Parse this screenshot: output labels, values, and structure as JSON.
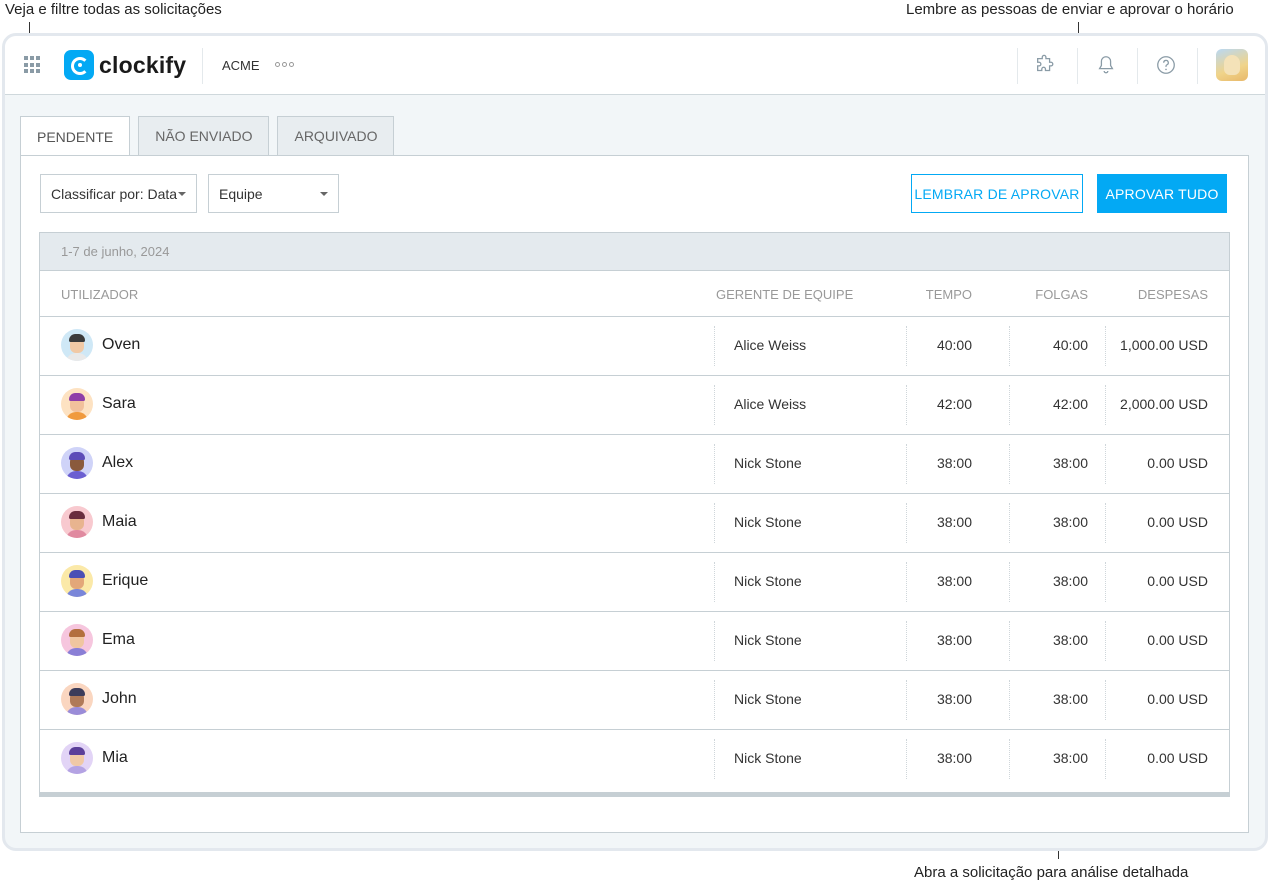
{
  "annotations": {
    "top_left": "Veja e filtre todas as solicitações",
    "top_right": "Lembre as pessoas de enviar e aprovar o horário",
    "bottom": "Abra a solicitação para análise detalhada"
  },
  "header": {
    "logo_text": "clockify",
    "workspace": "ACME",
    "icons": [
      "apps-grid-icon",
      "puzzle-icon",
      "bell-icon",
      "help-icon"
    ]
  },
  "tabs": [
    {
      "label": "PENDENTE",
      "active": true
    },
    {
      "label": "NÃO ENVIADO",
      "active": false
    },
    {
      "label": "ARQUIVADO",
      "active": false
    }
  ],
  "filters": {
    "sort": "Classificar por: Data",
    "team": "Equipe"
  },
  "actions": {
    "remind": "LEMBRAR DE APROVAR",
    "approve_all": "APROVAR TUDO"
  },
  "table": {
    "date_range": "1-7 de junho, 2024",
    "columns": {
      "user": "UTILIZADOR",
      "manager": "GERENTE DE EQUIPE",
      "time": "TEMPO",
      "timeoff": "FOLGAS",
      "expenses": "DESPESAS"
    },
    "rows": [
      {
        "name": "Oven",
        "manager": "Alice Weiss",
        "time": "40:00",
        "timeoff": "40:00",
        "expenses": "1,000.00 USD",
        "bg": "#cfe8f6",
        "hair": "#3b3b3b",
        "skin": "#f1c9a5",
        "shirt": "#e9e9e9"
      },
      {
        "name": "Sara",
        "manager": "Alice Weiss",
        "time": "42:00",
        "timeoff": "42:00",
        "expenses": "2,000.00 USD",
        "bg": "#fde2c2",
        "hair": "#8e3ea8",
        "skin": "#f2c19c",
        "shirt": "#f09a3e"
      },
      {
        "name": "Alex",
        "manager": "Nick Stone",
        "time": "38:00",
        "timeoff": "38:00",
        "expenses": "0.00 USD",
        "bg": "#cfd3f8",
        "hair": "#5c4bb8",
        "skin": "#8a5a3c",
        "shirt": "#6b5fd1"
      },
      {
        "name": "Maia",
        "manager": "Nick Stone",
        "time": "38:00",
        "timeoff": "38:00",
        "expenses": "0.00 USD",
        "bg": "#f8c9cf",
        "hair": "#6a2d3e",
        "skin": "#e8b48f",
        "shirt": "#e08aa0"
      },
      {
        "name": "Erique",
        "manager": "Nick Stone",
        "time": "38:00",
        "timeoff": "38:00",
        "expenses": "0.00 USD",
        "bg": "#fbe9a8",
        "hair": "#4b4fb5",
        "skin": "#e3a779",
        "shirt": "#7a86d9"
      },
      {
        "name": "Ema",
        "manager": "Nick Stone",
        "time": "38:00",
        "timeoff": "38:00",
        "expenses": "0.00 USD",
        "bg": "#f6c6de",
        "hair": "#b36f3e",
        "skin": "#f0c6a0",
        "shirt": "#8a7fd6"
      },
      {
        "name": "John",
        "manager": "Nick Stone",
        "time": "38:00",
        "timeoff": "38:00",
        "expenses": "0.00 USD",
        "bg": "#fad6c0",
        "hair": "#3c3c5a",
        "skin": "#b07a58",
        "shirt": "#9a8cd8"
      },
      {
        "name": "Mia",
        "manager": "Nick Stone",
        "time": "38:00",
        "timeoff": "38:00",
        "expenses": "0.00 USD",
        "bg": "#e2d4f6",
        "hair": "#5b3f99",
        "skin": "#f0c9a6",
        "shirt": "#b4a3e3"
      }
    ]
  }
}
